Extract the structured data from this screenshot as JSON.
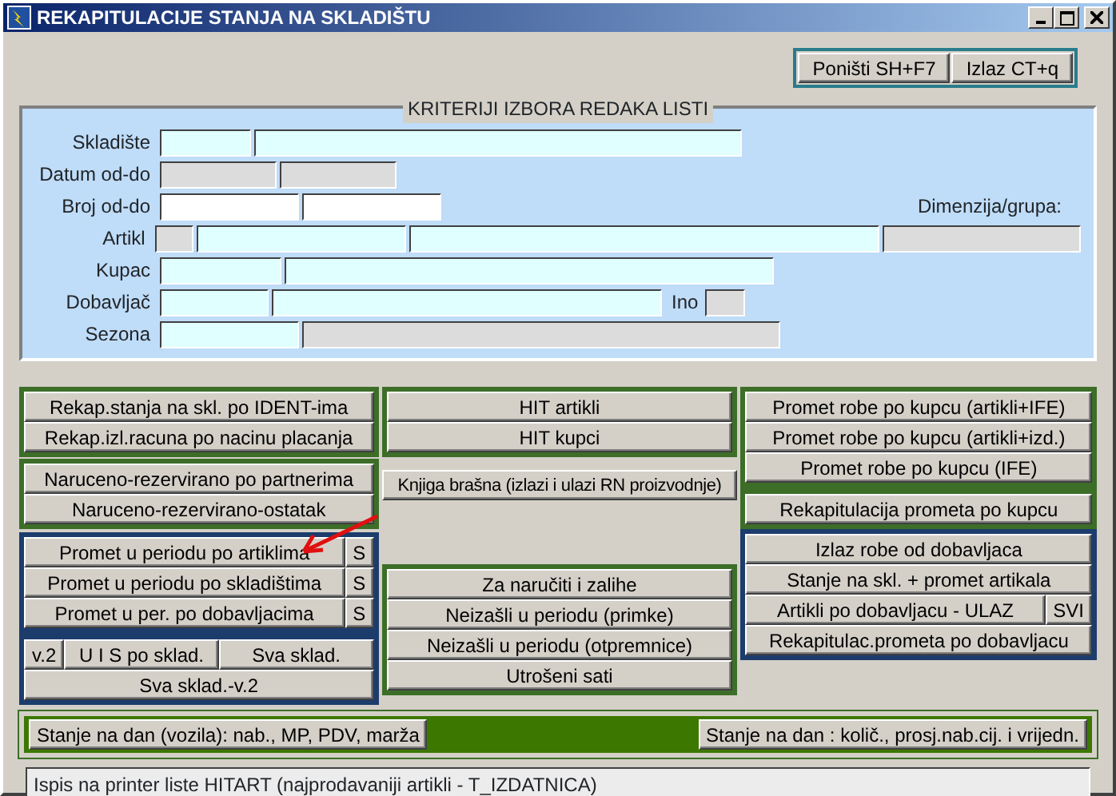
{
  "window": {
    "title": "REKAPITULACIJE STANJA NA SKLADIŠTU"
  },
  "top_buttons": [
    "Poništi SH+F7",
    "Izlaz CT+q"
  ],
  "criteria": {
    "legend": "KRITERIJI IZBORA REDAKA LISTI",
    "rows": [
      {
        "label": "Skladište",
        "items": [
          {
            "kind": "field",
            "disabled": false,
            "required": true
          },
          {
            "kind": "field",
            "disabled": false,
            "required": true
          }
        ]
      },
      {
        "label": "Datum  od-do",
        "items": [
          {
            "kind": "field",
            "disabled": true
          },
          {
            "kind": "field",
            "disabled": true
          }
        ]
      },
      {
        "label": "Broj od-do",
        "items": [
          {
            "kind": "field",
            "disabled": false,
            "required": false
          },
          {
            "kind": "field",
            "disabled": false,
            "required": false
          },
          {
            "kind": "label",
            "text": "Dimenzija/grupa:"
          }
        ]
      },
      {
        "label": "Artikl",
        "items": [
          {
            "kind": "field",
            "disabled": true
          },
          {
            "kind": "field",
            "disabled": false,
            "required": true
          },
          {
            "kind": "field",
            "disabled": false,
            "required": true
          },
          {
            "kind": "field",
            "disabled": true
          }
        ]
      },
      {
        "label": "Kupac",
        "items": [
          {
            "kind": "field",
            "disabled": false,
            "required": true
          },
          {
            "kind": "field",
            "disabled": false,
            "required": true
          }
        ]
      },
      {
        "label": "Dobavljač",
        "items": [
          {
            "kind": "field",
            "disabled": false,
            "required": true
          },
          {
            "kind": "field",
            "disabled": false,
            "required": true
          },
          {
            "kind": "label",
            "text": "Ino"
          },
          {
            "kind": "field",
            "disabled": true
          }
        ]
      },
      {
        "label": "Sezona",
        "items": [
          {
            "kind": "field",
            "disabled": false,
            "required": true
          },
          {
            "kind": "field",
            "disabled": true
          }
        ]
      }
    ]
  },
  "columns": [
    [
      {
        "color": "#3c6e28",
        "rows": [
          [
            {
              "kind": "button",
              "label": "Rekap.stanja na skl. po IDENT-ima"
            }
          ],
          [
            {
              "kind": "button",
              "label": "Rekap.izl.racuna po nacinu placanja"
            }
          ]
        ]
      },
      {
        "color": "#3c6e28",
        "rows": [
          [
            {
              "kind": "button",
              "label": "Naruceno-rezervirano po partnerima"
            }
          ],
          [
            {
              "kind": "button",
              "label": "Naruceno-rezervirano-ostatak"
            }
          ]
        ]
      },
      {
        "color": "#1c3c6c",
        "rows": [
          [
            {
              "kind": "button",
              "label": "Promet u periodu po artiklima"
            },
            {
              "kind": "narrow",
              "label": "S"
            }
          ],
          [
            {
              "kind": "button",
              "label": "Promet u periodu po skladištima"
            },
            {
              "kind": "narrow",
              "label": "S"
            }
          ],
          [
            {
              "kind": "button",
              "label": "Promet u per. po dobavljacima"
            },
            {
              "kind": "narrow",
              "label": "S"
            }
          ],
          [
            {
              "kind": "bar"
            }
          ],
          {
            "buttons": [
              {
                "kind": "narrow",
                "label": "v.2"
              },
              {
                "kind": "button",
                "label": "U I S po sklad."
              },
              {
                "kind": "button",
                "label": "Sva sklad."
              }
            ]
          },
          [
            {
              "kind": "button",
              "label": "Sva sklad.-v.2"
            }
          ]
        ]
      }
    ],
    [
      {
        "color": "#3c6e28",
        "rows": [
          [
            {
              "kind": "button",
              "label": "HIT artikli"
            }
          ],
          [
            {
              "kind": "button",
              "label": "HIT kupci"
            }
          ]
        ]
      },
      {
        "rows": [
          [
            {
              "kind": "button",
              "label": "Knjiga brašna (izlazi i ulazi RN proizvodnje)"
            }
          ]
        ]
      },
      {
        "color": "#3c6e28",
        "rows": [
          [
            {
              "kind": "button",
              "label": "Za naručiti i zalihe"
            }
          ],
          [
            {
              "kind": "button",
              "label": "Neizašli u periodu (primke)"
            }
          ],
          [
            {
              "kind": "button",
              "label": "Neizašli u periodu (otpremnice)"
            }
          ],
          [
            {
              "kind": "button",
              "label": "Utrošeni sati"
            }
          ]
        ]
      }
    ],
    [
      {
        "color": "#3c6e28",
        "rows": [
          [
            {
              "kind": "button",
              "label": "Promet robe po kupcu (artikli+IFE)"
            }
          ],
          [
            {
              "kind": "button",
              "label": "Promet robe po kupcu (artikli+izd.)"
            }
          ],
          [
            {
              "kind": "button",
              "label": "Promet robe po kupcu (IFE)"
            }
          ],
          [
            {
              "kind": "bar"
            }
          ],
          [
            {
              "kind": "button",
              "label": "Rekapitulacija prometa po kupcu"
            }
          ]
        ]
      },
      {
        "color": "#1c3c6c",
        "rows": [
          [
            {
              "kind": "button",
              "label": "Izlaz robe od dobavljaca"
            }
          ],
          [
            {
              "kind": "button",
              "label": "Stanje na skl. + promet artikala"
            }
          ],
          [
            {
              "kind": "button",
              "label": "Artikli po dobavljacu - ULAZ"
            },
            {
              "kind": "narrow",
              "label": "SVI"
            }
          ],
          [
            {
              "kind": "button",
              "label": "Rekapitulac.prometa po dobavljacu"
            }
          ]
        ]
      }
    ]
  ],
  "bottom_bar": {
    "color": "#3c7800",
    "buttons": [
      "Stanje na dan (vozila): nab., MP, PDV, marža",
      "Stanje na dan : količ., prosj.nab.cij. i vrijedn."
    ]
  },
  "status_bar": "Ispis na printer liste HITART (najprodavaniji artikli - T_IZDATNICA)"
}
